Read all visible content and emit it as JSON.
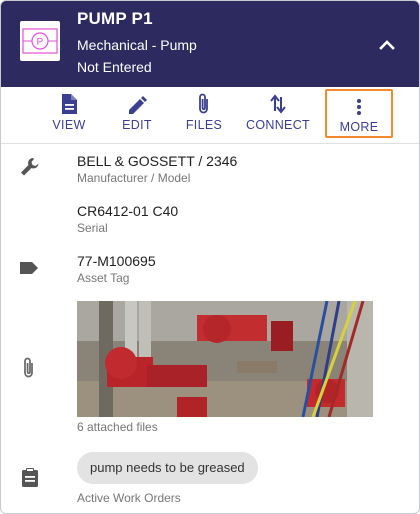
{
  "header": {
    "title": "PUMP P1",
    "subtitle": "Mechanical - Pump",
    "status": "Not Entered",
    "collapse_icon": "chevron-up-icon"
  },
  "toolbar": {
    "items": [
      {
        "label": "VIEW",
        "icon": "document-icon"
      },
      {
        "label": "EDIT",
        "icon": "pencil-icon"
      },
      {
        "label": "FILES",
        "icon": "paperclip-icon"
      },
      {
        "label": "CONNECT",
        "icon": "swap-arrows-icon"
      },
      {
        "label": "MORE",
        "icon": "more-vertical-icon"
      }
    ],
    "highlight_color": "#f28a2f"
  },
  "details": {
    "manufacturer": {
      "value": "BELL & GOSSETT / 2346",
      "label": "Manufacturer / Model",
      "icon": "wrench-icon"
    },
    "serial": {
      "value": "CR6412-01 C40",
      "label": "Serial"
    },
    "asset_tag": {
      "value": "77-M100695",
      "label": "Asset Tag",
      "icon": "tag-icon"
    },
    "attachments": {
      "caption": "6 attached files",
      "icon": "paperclip-icon"
    },
    "work_orders": {
      "chip": "pump needs to be greased",
      "label": "Active Work Orders",
      "icon": "clipboard-icon"
    }
  },
  "colors": {
    "header_bg": "#2c2a5e",
    "accent": "#3b3f8f"
  }
}
